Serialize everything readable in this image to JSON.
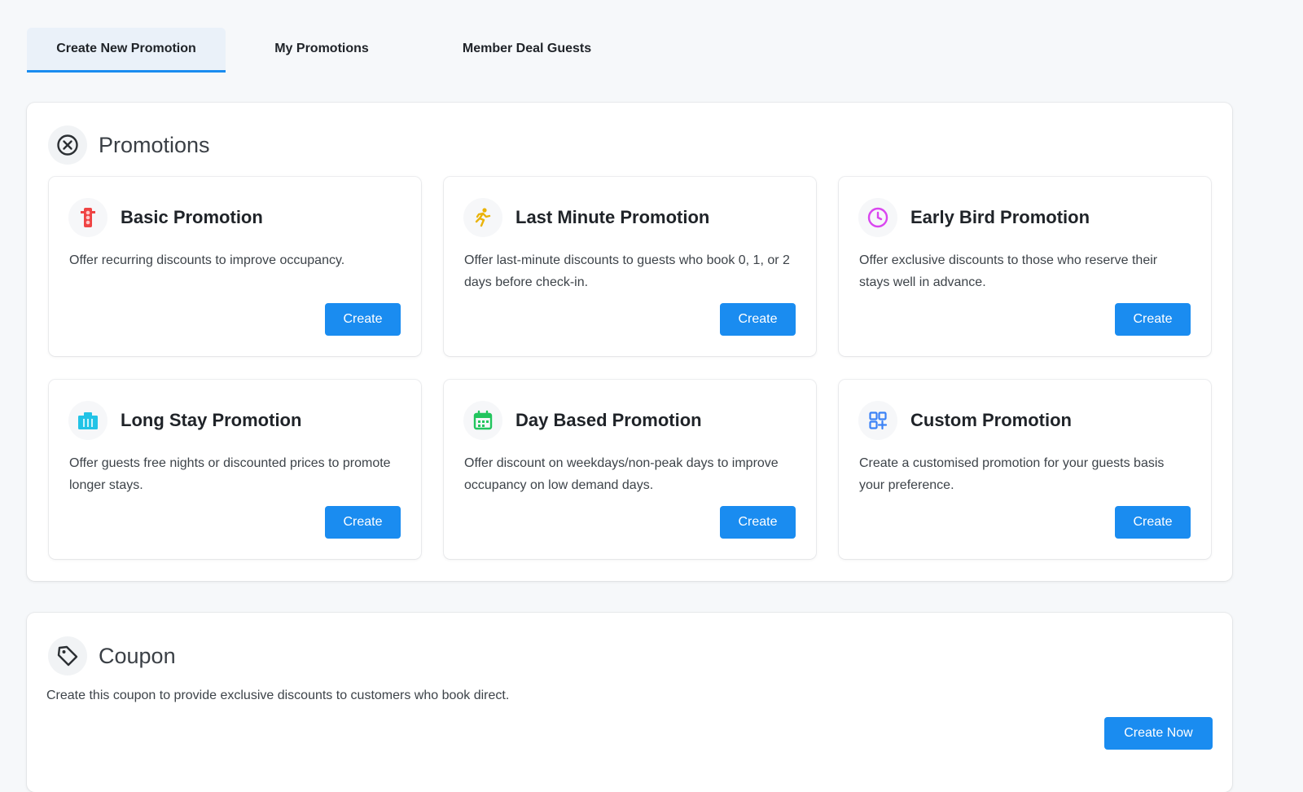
{
  "tabs": [
    {
      "label": "Create New Promotion",
      "active": true
    },
    {
      "label": "My Promotions",
      "active": false
    },
    {
      "label": "Member Deal Guests",
      "active": false
    }
  ],
  "promotions": {
    "title": "Promotions",
    "icon": "circle-x-icon",
    "cards": [
      {
        "title": "Basic Promotion",
        "description": "Offer recurring discounts to improve occupancy.",
        "button": "Create",
        "icon": "traffic-light-icon",
        "icon_color": "#ef4444"
      },
      {
        "title": "Last Minute Promotion",
        "description": "Offer last-minute discounts to guests who book 0, 1, or 2 days before check-in.",
        "button": "Create",
        "icon": "running-person-icon",
        "icon_color": "#eab308"
      },
      {
        "title": "Early Bird Promotion",
        "description": "Offer exclusive discounts to those who reserve their stays well in advance.",
        "button": "Create",
        "icon": "clock-icon",
        "icon_color": "#d946ef"
      },
      {
        "title": "Long Stay Promotion",
        "description": "Offer guests free nights or discounted prices to promote longer stays.",
        "button": "Create",
        "icon": "building-icon",
        "icon_color": "#22c3e6"
      },
      {
        "title": "Day Based Promotion",
        "description": "Offer discount on weekdays/non-peak days to improve occupancy on low demand days.",
        "button": "Create",
        "icon": "calendar-icon",
        "icon_color": "#22c55e"
      },
      {
        "title": "Custom Promotion",
        "description": "Create a customised promotion for your guests basis your preference.",
        "button": "Create",
        "icon": "grid-icon",
        "icon_color": "#3b82f6"
      }
    ]
  },
  "coupon": {
    "title": "Coupon",
    "icon": "tag-icon",
    "description": "Create this coupon to provide exclusive discounts to customers who book direct.",
    "button": "Create Now"
  },
  "colors": {
    "accent": "#1a8cf0",
    "background": "#f6f8fa"
  }
}
